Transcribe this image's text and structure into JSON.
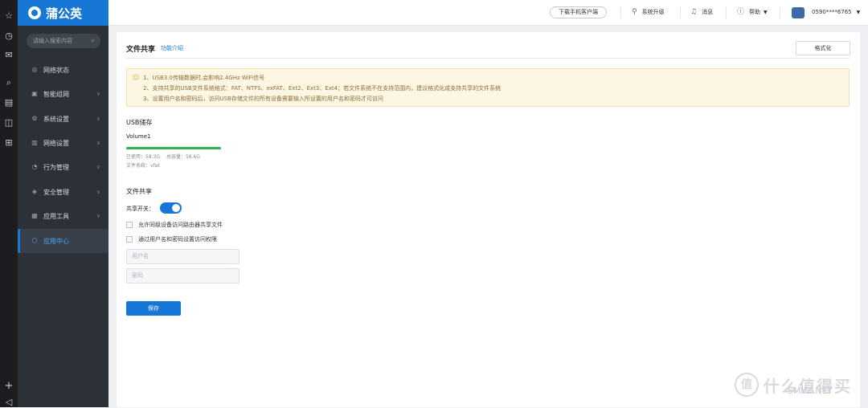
{
  "brand": {
    "name": "蒲公英"
  },
  "iconbar": {
    "icons": [
      "star-icon",
      "clock-icon",
      "mail-icon",
      "search-icon",
      "list-icon",
      "bag-icon",
      "gamepad-icon"
    ],
    "plus": "+",
    "collapse": "◁"
  },
  "sidebar": {
    "search_placeholder": "请输入搜索内容",
    "items": [
      {
        "label": "网络状态",
        "icon": "status-icon"
      },
      {
        "label": "智能组网",
        "icon": "network-icon"
      },
      {
        "label": "系统设置",
        "icon": "settings-icon"
      },
      {
        "label": "网络设置",
        "icon": "network-settings-icon"
      },
      {
        "label": "行为管理",
        "icon": "behavior-icon"
      },
      {
        "label": "安全管理",
        "icon": "security-icon"
      },
      {
        "label": "应用工具",
        "icon": "tools-icon"
      },
      {
        "label": "应用中心",
        "icon": "app-center-icon",
        "active": true
      }
    ]
  },
  "topbar": {
    "download_client": "下载手机客户端",
    "system_upgrade": "系统升级",
    "messages": "消息",
    "help": "帮助",
    "account": "0590****6765"
  },
  "page": {
    "title": "文件共享",
    "intro_link": "功能介绍",
    "format_button": "格式化",
    "notices": [
      "1、USB3.0传输数据时,会影响2.4GHz WiFi信号",
      "2、支持共享的USB文件系统格式：FAT、NTFS、exFAT、Ext2、Ext3、Ext4；若文件系统不在支持范围内，建议格式化成支持共享的文件系统",
      "3、设置用户名和密码后，访问USB存储文件的所有设备需要输入所设置的用户名和密码才可访问"
    ],
    "usb_section": "USB储存",
    "volume_name": "Volume1",
    "used": "已使用：58.3G",
    "total": "总容量：58.6G",
    "filesystem": "文件系统：vfat",
    "usage_fraction": 0.995,
    "share_section": "文件共享",
    "share_toggle_label": "共享开关：",
    "share_enabled": true,
    "checkbox_lan": "允许同级设备访问路由器共享文件",
    "checkbox_auth": "通过用户名和密码设置访问权限",
    "username_placeholder": "用户名",
    "password_placeholder": "密码",
    "save_button": "保存"
  },
  "watermark": {
    "glyph": "值",
    "text": "什么值得买",
    "sub": "SMYZ.NET"
  },
  "colors": {
    "brand": "#1677d7",
    "sidebar_bg": "#2c3137",
    "usage_bar": "#2bb24c",
    "notice_bg": "#fdf6e3"
  }
}
